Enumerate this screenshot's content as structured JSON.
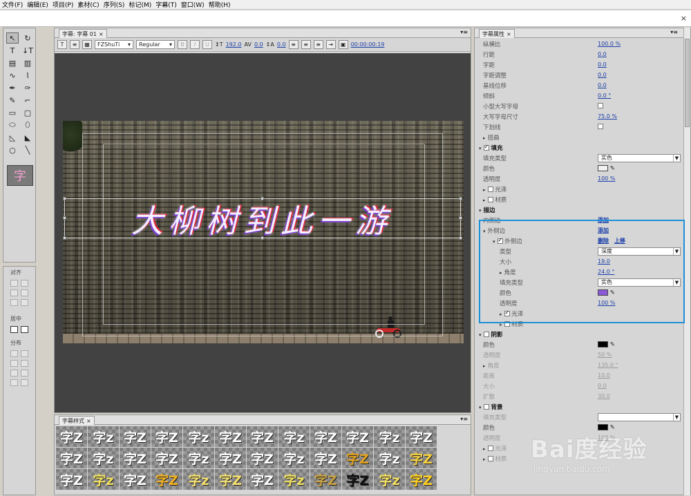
{
  "menu": [
    "文件(F)",
    "编辑(E)",
    "项目(P)",
    "素材(C)",
    "序列(S)",
    "标记(M)",
    "字幕(T)",
    "窗口(W)",
    "帮助(H)"
  ],
  "close_glyph": "×",
  "titler": {
    "tab": "字幕: 字幕 01",
    "font_family": "FZShuTi",
    "font_style": "Regular",
    "font_size": "192.0",
    "kerning": "0.0",
    "leading": "0.0",
    "timecode": "00:00:00:19",
    "caption": "大柳树到此一游"
  },
  "align_panel": {
    "align_label": "对齐",
    "center_label": "居中",
    "distribute_label": "分布"
  },
  "styles": {
    "tab": "字幕样式",
    "glyph_a": "字Z",
    "glyph_b": "字z",
    "colors": [
      "#ffffff",
      "#ffffff",
      "#ffffff",
      "#ffffff",
      "#ffffff",
      "#ffffff",
      "#ffffff",
      "#ffffff",
      "#ffffff",
      "#ffffff",
      "#ffffff",
      "#ffffff",
      "#ffffff",
      "#ffffff",
      "#ffffff",
      "#ffffff",
      "#ffffff",
      "#ffffff",
      "#ffffff",
      "#ffffff",
      "#ffffff",
      "#e0a020",
      "#ffffff",
      "#f5d040",
      "#ffffff",
      "#f0e060",
      "#ffffff",
      "#f0b020",
      "#f5e070",
      "#f5e070",
      "#ffffff",
      "#f0e060",
      "#c8a040",
      "#111111",
      "#f5e060",
      "#ffd020"
    ]
  },
  "props": {
    "tab": "字幕属性",
    "rows": [
      {
        "label": "纵横比",
        "value": "100.0 %",
        "indent": 1,
        "type": "val"
      },
      {
        "label": "行距",
        "value": "0.0",
        "indent": 1,
        "type": "val"
      },
      {
        "label": "字距",
        "value": "0.0",
        "indent": 1,
        "type": "val"
      },
      {
        "label": "字距调整",
        "value": "0.0",
        "indent": 1,
        "type": "val"
      },
      {
        "label": "基线位移",
        "value": "0.0",
        "indent": 1,
        "type": "val"
      },
      {
        "label": "倾斜",
        "value": "0.0 °",
        "indent": 1,
        "type": "val"
      },
      {
        "label": "小型大写字母",
        "value": "",
        "indent": 1,
        "type": "chk"
      },
      {
        "label": "大写字母尺寸",
        "value": "75.0 %",
        "indent": 1,
        "type": "val"
      },
      {
        "label": "下划线",
        "value": "",
        "indent": 1,
        "type": "chk"
      },
      {
        "label": "扭曲",
        "value": "",
        "indent": 1,
        "type": "group"
      },
      {
        "label": "填充",
        "value": "",
        "indent": 0,
        "type": "section-on"
      },
      {
        "label": "填充类型",
        "value": "实色",
        "indent": 1,
        "type": "drop"
      },
      {
        "label": "颜色",
        "value": "#f2f2f2",
        "indent": 1,
        "type": "color"
      },
      {
        "label": "透明度",
        "value": "100 %",
        "indent": 1,
        "type": "val"
      },
      {
        "label": "光泽",
        "value": "",
        "indent": 1,
        "type": "group-chk"
      },
      {
        "label": "材质",
        "value": "",
        "indent": 1,
        "type": "group-chk"
      },
      {
        "label": "描边",
        "value": "",
        "indent": 0,
        "type": "section"
      },
      {
        "label": "内侧边",
        "value": "添加",
        "indent": 1,
        "type": "link"
      },
      {
        "label": "外侧边",
        "value": "添加",
        "indent": 1,
        "type": "link-open"
      },
      {
        "label": "外侧边",
        "value": "删除",
        "value2": "上移",
        "indent": 2,
        "type": "link2"
      },
      {
        "label": "类型",
        "value": "深度",
        "indent": 3,
        "type": "drop"
      },
      {
        "label": "大小",
        "value": "19.0",
        "indent": 3,
        "type": "val"
      },
      {
        "label": "角度",
        "value": "24.0 °",
        "indent": 3,
        "type": "val-group"
      },
      {
        "label": "填充类型",
        "value": "实色",
        "indent": 3,
        "type": "drop"
      },
      {
        "label": "颜色",
        "value": "#8a5ad8",
        "indent": 3,
        "type": "color"
      },
      {
        "label": "透明度",
        "value": "100 %",
        "indent": 3,
        "type": "val"
      },
      {
        "label": "光泽",
        "value": "",
        "indent": 3,
        "type": "group-chk-on"
      },
      {
        "label": "材质",
        "value": "",
        "indent": 3,
        "type": "group-chk"
      },
      {
        "label": "阴影",
        "value": "",
        "indent": 0,
        "type": "section-chk"
      },
      {
        "label": "颜色",
        "value": "#000000",
        "indent": 1,
        "type": "color"
      },
      {
        "label": "透明度",
        "value": "50 %",
        "indent": 1,
        "type": "val-dim"
      },
      {
        "label": "角度",
        "value": "135.0 °",
        "indent": 1,
        "type": "val-group-dim"
      },
      {
        "label": "距离",
        "value": "10.0",
        "indent": 1,
        "type": "val-dim"
      },
      {
        "label": "大小",
        "value": "0.0",
        "indent": 1,
        "type": "val-dim"
      },
      {
        "label": "扩散",
        "value": "30.0",
        "indent": 1,
        "type": "val-dim"
      },
      {
        "label": "背景",
        "value": "",
        "indent": 0,
        "type": "section-chk"
      },
      {
        "label": "填充类型",
        "value": "",
        "indent": 1,
        "type": "drop-dim"
      },
      {
        "label": "颜色",
        "value": "#000000",
        "indent": 1,
        "type": "color"
      },
      {
        "label": "透明度",
        "value": "100 %",
        "indent": 1,
        "type": "val-dim"
      },
      {
        "label": "光泽",
        "value": "",
        "indent": 1,
        "type": "group-chk-dim"
      },
      {
        "label": "材质",
        "value": "",
        "indent": 1,
        "type": "group-chk-dim"
      }
    ]
  },
  "watermark": {
    "brand": "Bai度经验",
    "url": "jingyan.baidu.com"
  }
}
